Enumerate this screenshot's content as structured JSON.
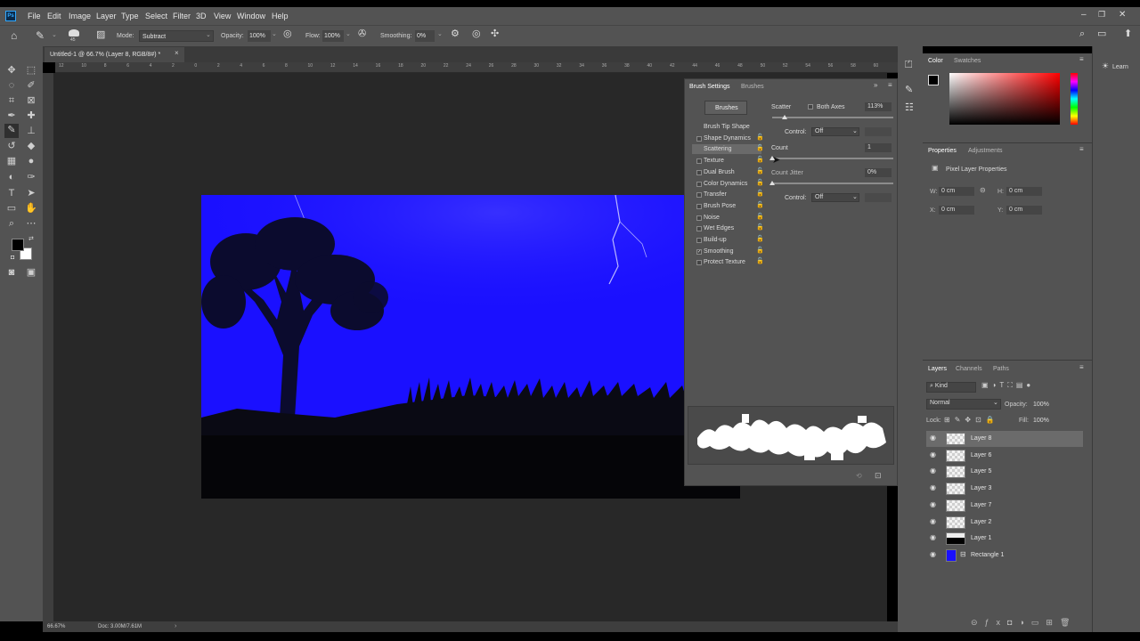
{
  "menu": [
    "File",
    "Edit",
    "Image",
    "Layer",
    "Type",
    "Select",
    "Filter",
    "3D",
    "View",
    "Window",
    "Help"
  ],
  "options_bar": {
    "brush_size": "45",
    "mode_label": "Mode:",
    "mode_value": "Subtract",
    "opacity_label": "Opacity:",
    "opacity_value": "100%",
    "flow_label": "Flow:",
    "flow_value": "100%",
    "smoothing_label": "Smoothing:",
    "smoothing_value": "0%"
  },
  "document_tab": "Untitled-1 @ 66.7% (Layer 8, RGB/8#) *",
  "ruler_labels": [
    "12",
    "10",
    "8",
    "6",
    "4",
    "2",
    "0",
    "2",
    "4",
    "6",
    "8",
    "10",
    "12",
    "14",
    "16",
    "18",
    "20",
    "22",
    "24",
    "26",
    "28",
    "30",
    "32",
    "34",
    "36",
    "38",
    "40",
    "42",
    "44",
    "46",
    "48",
    "50",
    "52",
    "54",
    "56",
    "58",
    "60"
  ],
  "status": {
    "zoom": "66.67%",
    "doc": "Doc: 3.00M/7.61M"
  },
  "brush_settings": {
    "tabs": [
      "Brush Settings",
      "Brushes"
    ],
    "brushes_button": "Brushes",
    "items": [
      {
        "label": "Brush Tip Shape",
        "checkbox": false,
        "checked": false,
        "lock": false
      },
      {
        "label": "Shape Dynamics",
        "checkbox": true,
        "checked": false,
        "lock": true
      },
      {
        "label": "Scattering",
        "checkbox": true,
        "checked": true,
        "lock": true
      },
      {
        "label": "Texture",
        "checkbox": true,
        "checked": false,
        "lock": true
      },
      {
        "label": "Dual Brush",
        "checkbox": true,
        "checked": false,
        "lock": true
      },
      {
        "label": "Color Dynamics",
        "checkbox": true,
        "checked": false,
        "lock": true
      },
      {
        "label": "Transfer",
        "checkbox": true,
        "checked": false,
        "lock": true
      },
      {
        "label": "Brush Pose",
        "checkbox": true,
        "checked": false,
        "lock": true
      },
      {
        "label": "Noise",
        "checkbox": true,
        "checked": false,
        "lock": true
      },
      {
        "label": "Wet Edges",
        "checkbox": true,
        "checked": false,
        "lock": true
      },
      {
        "label": "Build-up",
        "checkbox": true,
        "checked": false,
        "lock": true
      },
      {
        "label": "Smoothing",
        "checkbox": true,
        "checked": true,
        "lock": true
      },
      {
        "label": "Protect Texture",
        "checkbox": true,
        "checked": false,
        "lock": true
      }
    ],
    "scatter_label": "Scatter",
    "both_axes_label": "Both Axes",
    "scatter_value": "113%",
    "control_label": "Control:",
    "control_value": "Off",
    "count_label": "Count",
    "count_value": "1",
    "count_jitter_label": "Count Jitter",
    "count_jitter_value": "0%",
    "control2_label": "Control:",
    "control2_value": "Off"
  },
  "color_panel": {
    "tabs": [
      "Color",
      "Swatches"
    ]
  },
  "properties_panel": {
    "tabs": [
      "Properties",
      "Adjustments"
    ],
    "title": "Pixel Layer Properties",
    "w_label": "W:",
    "w_value": "0 cm",
    "h_label": "H:",
    "h_value": "0 cm",
    "x_label": "X:",
    "x_value": "0 cm",
    "y_label": "Y:",
    "y_value": "0 cm"
  },
  "layers_panel": {
    "tabs": [
      "Layers",
      "Channels",
      "Paths"
    ],
    "kind": "Kind",
    "blend": "Normal",
    "opacity_label": "Opacity:",
    "opacity_value": "100%",
    "lock_label": "Lock:",
    "fill_label": "Fill:",
    "fill_value": "100%",
    "layers": [
      "Layer 8",
      "Layer 6",
      "Layer 5",
      "Layer 3",
      "Layer 7",
      "Layer 2",
      "Layer 1",
      "Rectangle 1"
    ]
  },
  "learn_label": "Learn",
  "colors": {
    "canvas_blue": "#1a10ff",
    "ui_panel": "#535353",
    "selected_layer": "#6b6b6b"
  }
}
